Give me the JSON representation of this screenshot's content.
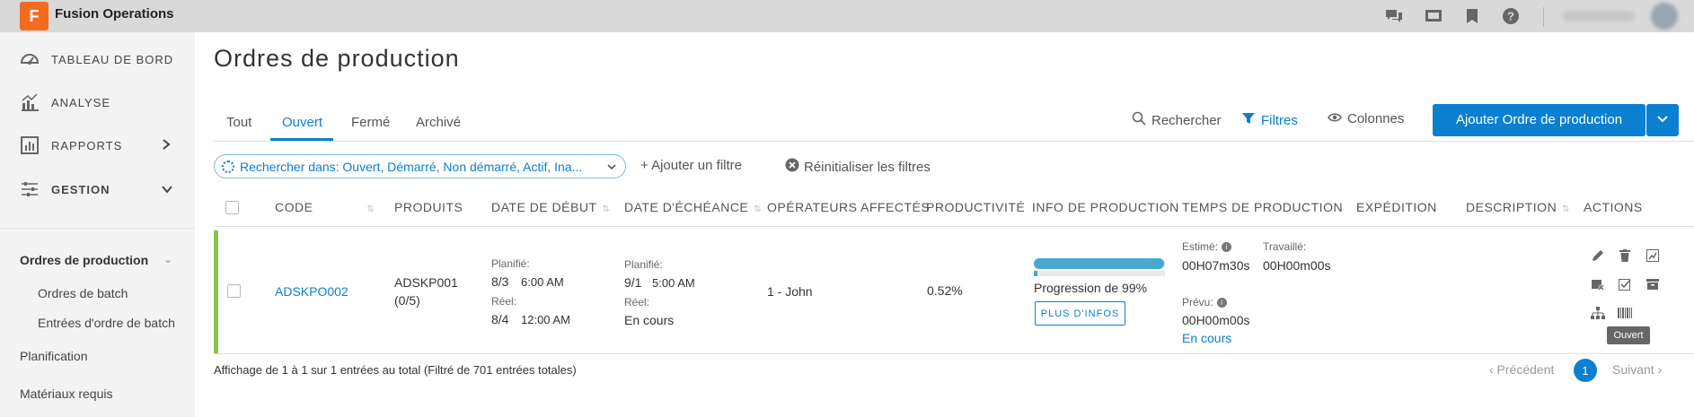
{
  "app": {
    "logo_letter": "F",
    "title": "Fusion Operations"
  },
  "topbar_icons": [
    "chat-icon",
    "monitor-icon",
    "bookmark-icon",
    "help-icon"
  ],
  "sidebar": {
    "main_items": [
      {
        "label": "TABLEAU DE BORD",
        "icon": "dashboard-icon"
      },
      {
        "label": "ANALYSE",
        "icon": "chart-icon"
      },
      {
        "label": "RAPPORTS",
        "icon": "report-icon"
      },
      {
        "label": "GESTION",
        "icon": "settings-sliders-icon"
      }
    ],
    "section_title": "Ordres de production",
    "sub_items": [
      "Ordres de batch",
      "Entrées d'ordre de batch"
    ],
    "bottom_items": [
      "Planification",
      "Matériaux requis"
    ]
  },
  "page": {
    "title": "Ordres de production"
  },
  "tabs": [
    "Tout",
    "Ouvert",
    "Fermé",
    "Archivé"
  ],
  "active_tab": "Ouvert",
  "toolbar": {
    "search_label": "Rechercher",
    "filters_label": "Filtres",
    "columns_label": "Colonnes",
    "add_label": "Ajouter Ordre de production"
  },
  "filters": {
    "chip_text": "Rechercher dans: Ouvert, Démarré, Non démarré, Actif, Ina...",
    "add_filter": "+ Ajouter un filtre",
    "reset_filters": "Réinitialiser les filtres"
  },
  "table": {
    "headers": [
      "CODE",
      "PRODUITS",
      "DATE DE DÉBUT",
      "DATE D'ÉCHÉANCE",
      "OPÉRATEURS AFFECTÉS",
      "PRODUCTIVITÉ",
      "INFO DE PRODUCTION",
      "TEMPS DE PRODUCTION",
      "EXPÉDITION",
      "DESCRIPTION",
      "ACTIONS"
    ],
    "row": {
      "code": "ADSKPO002",
      "product_code": "ADSKP001",
      "product_count": "(0/5)",
      "start_planned_label": "Planifié:",
      "start_planned_date": "8/3",
      "start_planned_time": "6:00 AM",
      "start_real_label": "Réel:",
      "start_real_date": "8/4",
      "start_real_time": "12:00 AM",
      "due_planned_label": "Planifié:",
      "due_planned_date": "9/1",
      "due_planned_time": "5:00 AM",
      "due_real_label": "Réel:",
      "due_real_value": "En cours",
      "operators": "1 - John",
      "productivity": "0.52%",
      "progress_fraction": 0.99,
      "progress_text": "Progression de 99%",
      "more_info": "PLUS D'INFOS",
      "estimated_label": "Estimé:",
      "estimated_value": "00H07m30s",
      "worked_label": "Travaillé:",
      "worked_value": "00H00m00s",
      "planned_label": "Prévu:",
      "planned_value": "00H00m00s",
      "status_link": "En cours",
      "tooltip": "Ouvert",
      "row_color": "#8bc34a"
    }
  },
  "footer": {
    "summary": "Affichage de 1 à 1 sur 1 entrées au total (Filtré de 701 entrées totales)",
    "prev": "‹ Précédent",
    "page": "1",
    "next": "Suivant ›"
  },
  "colors": {
    "accent": "#0b7fd0",
    "progress": "#47a9d1",
    "brand": "#f26b21"
  }
}
